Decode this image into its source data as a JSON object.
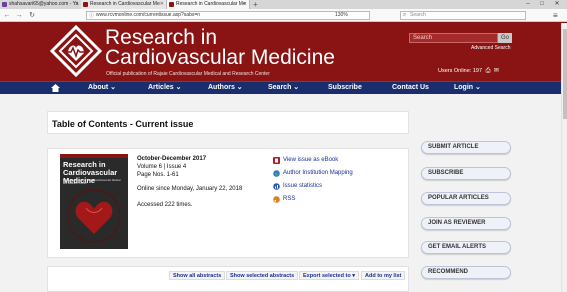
{
  "browser": {
    "tabs": [
      {
        "label": "shahsavari65@yahoo.com - Ya"
      },
      {
        "label": "Research in Cardiovascular Me"
      },
      {
        "label": "Research in Cardiovascular Me"
      }
    ],
    "url": "www.rcvmonline.com/currentissue.asp?sabs=n",
    "zoom": "130%",
    "search_placeholder": "Search"
  },
  "header": {
    "title_line1": "Research in",
    "title_line2": "Cardiovascular Medicine",
    "subtitle": "Official publication of Rajaie Cardiovascular Medical and Research Center",
    "search_placeholder": "Search",
    "go_label": "Go",
    "advanced_search": "Advanced Search",
    "users_online": "Users Online: 197"
  },
  "menu": {
    "items": [
      "About",
      "Articles",
      "Authors",
      "Search",
      "Subscribe",
      "Contact Us",
      "Login"
    ]
  },
  "main": {
    "toc_title": "Table of Contents - Current issue",
    "cover": {
      "title_line1": "Research in",
      "title_line2": "Cardiovascular Medicine",
      "small": "Official publication of Rajaie Cardiovascular Medical and Research Center"
    },
    "issue": {
      "period": "October-December 2017",
      "volume": "Volume 6 | Issue 4",
      "pages": "Page Nos. 1-61",
      "online_since": "Online since Monday, January 22, 2018",
      "accessed": "Accessed 222 times."
    },
    "links": [
      "View issue as eBook",
      "Author Institution Mapping",
      "Issue statistics",
      "RSS"
    ],
    "actions": [
      "Show all abstracts",
      "Show selected abstracts",
      "Export selected to",
      "Add to my list"
    ]
  },
  "sidebar": {
    "buttons": [
      "SUBMIT ARTICLE",
      "SUBSCRIBE",
      "POPULAR ARTICLES",
      "JOIN AS REVIEWER",
      "GET EMAIL ALERTS",
      "RECOMMEND"
    ]
  },
  "colors": {
    "header": "#8a1414",
    "menubar": "#1a2e6e",
    "link": "#1a2e9a"
  }
}
